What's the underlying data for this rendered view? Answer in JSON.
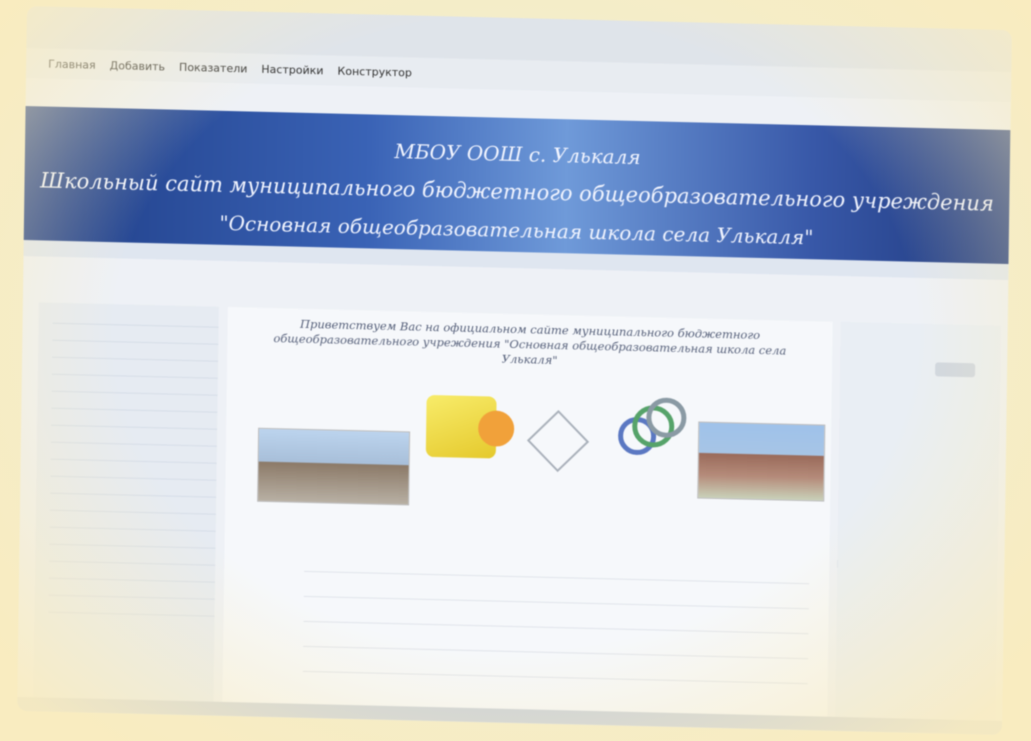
{
  "browser": {
    "tabs": [
      "",
      "",
      "",
      ""
    ],
    "menu": [
      "Главная",
      "Добавить",
      "Показатели",
      "Настройки",
      "Конструктор"
    ]
  },
  "banner": {
    "line1": "МБОУ ООШ с. Улькаля",
    "line2": "Школьный сайт муниципального бюджетного общеобразовательного учреждения",
    "line3": "\"Основная общеобразовательная школа села Улькаля\""
  },
  "welcome": "Приветствуем Вас на официальном сайте муниципального бюджетного общеобразовательного учреждения \"Основная общеобразовательная школа села Улькаля\"",
  "images": {
    "caption1": "",
    "caption2": ""
  },
  "address": "",
  "colors": {
    "banner": "#2a4d9b",
    "screen": "#eef1f6",
    "frame": "#f4edc9"
  }
}
